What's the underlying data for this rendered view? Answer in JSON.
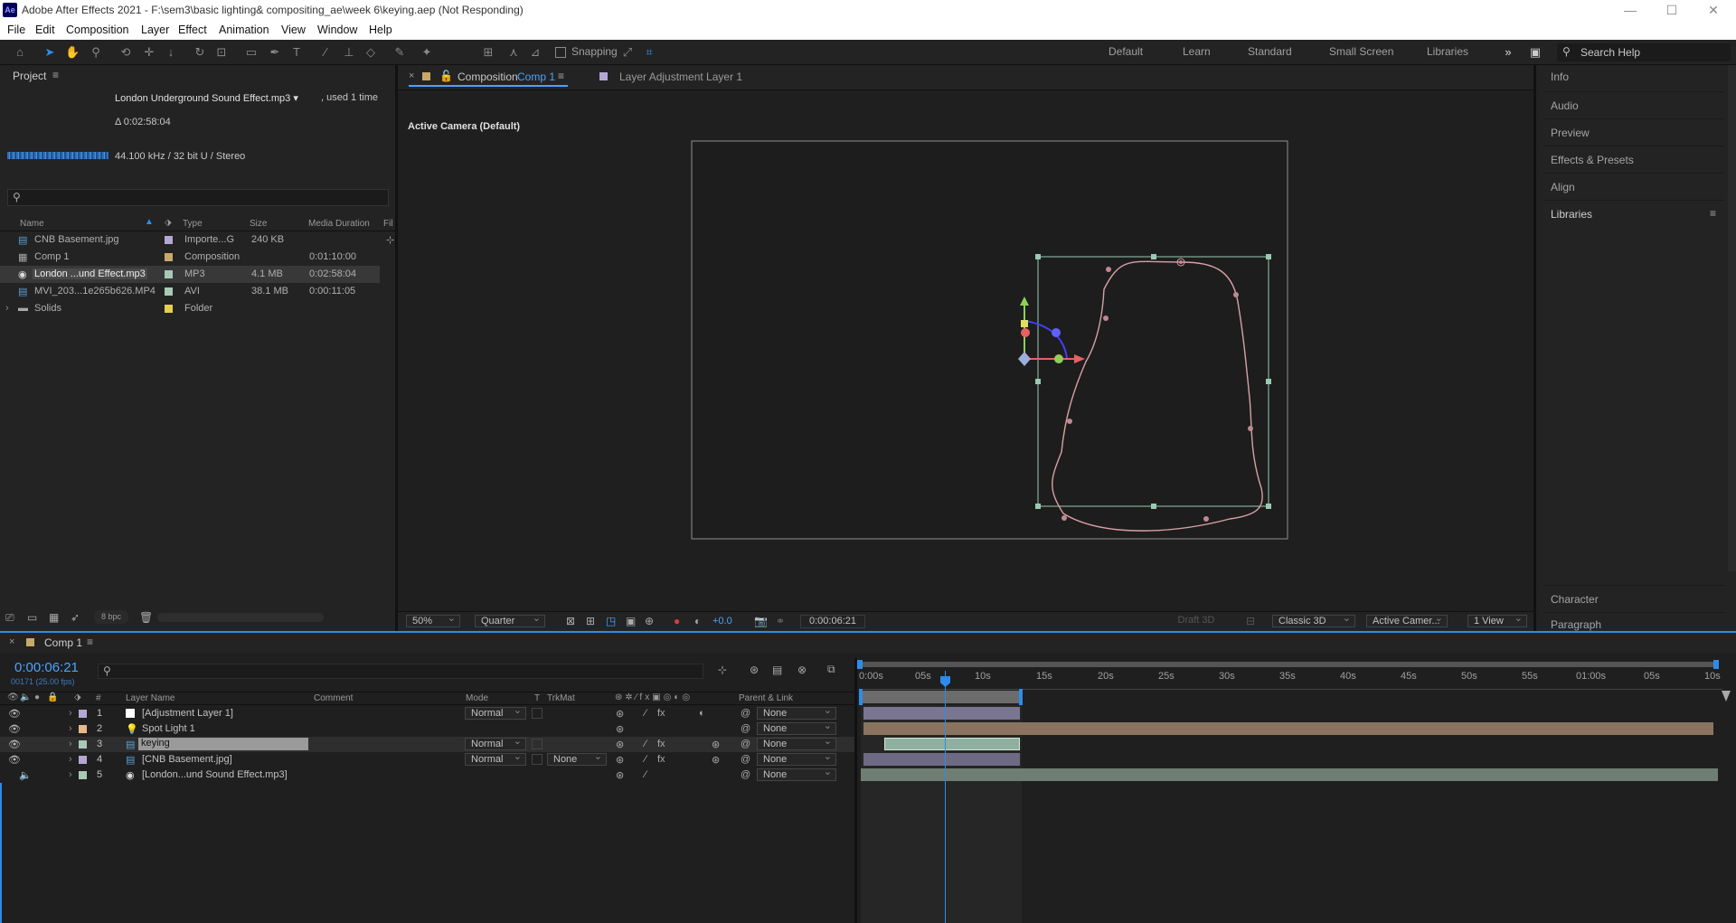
{
  "window": {
    "title": "Adobe After Effects 2021 - F:\\sem3\\basic lighting& compositing_ae\\week 6\\keying.aep (Not Responding)",
    "logo": "Ae"
  },
  "menu": [
    "File",
    "Edit",
    "Composition",
    "Layer",
    "Effect",
    "Animation",
    "View",
    "Window",
    "Help"
  ],
  "toolbar": {
    "snapping": "Snapping",
    "workspaces": [
      "Default",
      "Learn",
      "Standard",
      "Small Screen",
      "Libraries"
    ],
    "search_help": "Search Help"
  },
  "project": {
    "tab": "Project",
    "selected_name": "London Underground Sound Effect.mp3 ▾",
    "used": ", used 1 time",
    "duration": "Δ 0:02:58:04",
    "audio_info": "44.100 kHz / 32 bit U / Stereo",
    "columns": [
      "Name",
      "Type",
      "Size",
      "Media Duration",
      "Fil"
    ],
    "items": [
      {
        "name": "CNB Basement.jpg",
        "type": "Importe...G",
        "size": "240 KB",
        "duration": "",
        "color": "#b4a7d6"
      },
      {
        "name": "Comp 1",
        "type": "Composition",
        "size": "",
        "duration": "0:01:10:00",
        "color": "#c9a86a"
      },
      {
        "name": "London ...und Effect.mp3",
        "type": "MP3",
        "size": "4.1 MB",
        "duration": "0:02:58:04",
        "color": "#a9c9b4"
      },
      {
        "name": "MVI_203...1e265b626.MP4",
        "type": "AVI",
        "size": "38.1 MB",
        "duration": "0:00:11:05",
        "color": "#a9c9b4"
      },
      {
        "name": "Solids",
        "type": "Folder",
        "size": "",
        "duration": "",
        "color": "#e6d04a"
      }
    ],
    "bpc": "8 bpc"
  },
  "comp_viewer": {
    "tab_comp_prefix": "Composition",
    "tab_comp_name": "Comp 1",
    "tab_layer": "Layer  Adjustment Layer 1",
    "camera_label": "Active Camera (Default)",
    "zoom": "50%",
    "resolution": "Quarter",
    "exposure": "+0.0",
    "timecode": "0:00:06:21",
    "draft3d": "Draft 3D",
    "renderer": "Classic 3D",
    "view": "Active Camer...",
    "views": "1 View"
  },
  "right_panels": [
    "Info",
    "Audio",
    "Preview",
    "Effects & Presets",
    "Align",
    "Libraries"
  ],
  "right_bottom": [
    "Character",
    "Paragraph"
  ],
  "timeline": {
    "tab": "Comp 1",
    "timecode": "0:00:06:21",
    "fps": "00171 (25.00 fps)",
    "headers": {
      "layer_name": "Layer Name",
      "comment": "Comment",
      "mode": "Mode",
      "t": "T",
      "trkmat": "TrkMat",
      "parent": "Parent & Link"
    },
    "ruler": [
      "0:00s",
      "05s",
      "10s",
      "15s",
      "20s",
      "25s",
      "30s",
      "35s",
      "40s",
      "45s",
      "50s",
      "55s",
      "01:00s",
      "05s",
      "10s"
    ],
    "layers": [
      {
        "num": "1",
        "name": "[Adjustment Layer 1]",
        "mode": "Normal",
        "trkmat": "",
        "parent": "None",
        "color": "#b4a7d6"
      },
      {
        "num": "2",
        "name": "Spot Light 1",
        "mode": "",
        "trkmat": "",
        "parent": "None",
        "color": "#e8b88a"
      },
      {
        "num": "3",
        "name": "keying",
        "mode": "Normal",
        "trkmat": "",
        "parent": "None",
        "color": "#a9c9b4"
      },
      {
        "num": "4",
        "name": "[CNB Basement.jpg]",
        "mode": "Normal",
        "trkmat": "None",
        "parent": "None",
        "color": "#b4a7d6"
      },
      {
        "num": "5",
        "name": "[London...und Sound Effect.mp3]",
        "mode": "",
        "trkmat": "",
        "parent": "None",
        "color": "#a9c9b4"
      }
    ]
  }
}
